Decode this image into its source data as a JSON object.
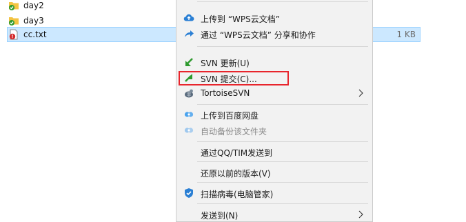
{
  "files": [
    {
      "name": "day2",
      "icon": "folder-check-icon",
      "size": ""
    },
    {
      "name": "day3",
      "icon": "folder-check-icon",
      "size": ""
    },
    {
      "name": "cc.txt",
      "icon": "text-file-conflict-icon",
      "size": "1 KB",
      "selected": true
    }
  ],
  "menu": {
    "items": [
      {
        "label": "上传到 “WPS云文档”",
        "icon": "cloud-upload-icon",
        "enabled": true
      },
      {
        "label": "通过 “WPS云文档” 分享和协作",
        "icon": "share-icon",
        "enabled": true
      },
      {
        "label": "SVN 更新(U)",
        "icon": "svn-update-icon",
        "enabled": true
      },
      {
        "label": "SVN 提交(C)...",
        "icon": "svn-commit-icon",
        "enabled": true,
        "highlighted": true
      },
      {
        "label": "TortoiseSVN",
        "icon": "tortoisesvn-icon",
        "enabled": true,
        "submenu": true
      },
      {
        "label": "上传到百度网盘",
        "icon": "baidu-netdisk-icon",
        "enabled": true
      },
      {
        "label": "自动备份该文件夹",
        "icon": "baidu-netdisk-icon",
        "enabled": false
      },
      {
        "label": "通过QQ/TIM发送到",
        "icon": "",
        "enabled": true
      },
      {
        "label": "还原以前的版本(V)",
        "icon": "",
        "enabled": true
      },
      {
        "label": "扫描病毒(电脑管家)",
        "icon": "shield-icon",
        "enabled": true
      },
      {
        "label": "发送到(N)",
        "icon": "",
        "enabled": true,
        "submenu": true
      }
    ]
  },
  "colors": {
    "selection_bg": "#cce8ff",
    "menu_bg": "#f2f2f2",
    "highlight_border": "#e8252c",
    "svn_green": "#2e9a2e",
    "wps_blue": "#2a7fd4"
  }
}
